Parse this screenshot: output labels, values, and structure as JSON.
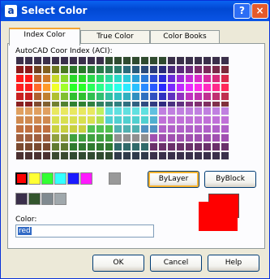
{
  "window": {
    "title": "Select Color",
    "icon_letter": "a"
  },
  "titlebar_buttons": {
    "help_label": "?",
    "close_label": "×"
  },
  "tabs": [
    {
      "label": "Index Color",
      "active": true
    },
    {
      "label": "True Color",
      "active": false
    },
    {
      "label": "Color Books",
      "active": false
    }
  ],
  "aci_label": "AutoCAD Coor Index (ACI):",
  "palette_cols": 24,
  "palette_top": [
    [
      "#3a2f4a",
      "#3a2f4a",
      "#3a2f4a",
      "#3a2f4a",
      "#3a2f4a",
      "#3a2f4a",
      "#3a2f4a",
      "#3a2f4a",
      "#3a2f4a",
      "#3a2f4a",
      "#2f4a2f",
      "#2f4a2f",
      "#2f4a2f",
      "#2f4a2f",
      "#2f4a2f",
      "#2f4a2f",
      "#2f4a2f",
      "#3a2f4a",
      "#3a2f4a",
      "#3a2f4a",
      "#3a2f4a",
      "#3a2f4a",
      "#3a2f4a",
      "#3a2f4a"
    ],
    [
      "#8b1a1a",
      "#8b1a1a",
      "#704020",
      "#806020",
      "#6e7a20",
      "#4a7a20",
      "#2a7a2a",
      "#2a7a2a",
      "#2a7a3a",
      "#2a7a4a",
      "#2a7a5a",
      "#2a7a6a",
      "#2a6a7a",
      "#2a5a7a",
      "#2a4a7a",
      "#2a3a7a",
      "#2a2a7a",
      "#4a2a7a",
      "#5a2a7a",
      "#6a2a7a",
      "#7a2a6a",
      "#7a2a5a",
      "#7a2a4a",
      "#7a2a3a"
    ],
    [
      "#ff1a1a",
      "#ff1a1a",
      "#c0602a",
      "#d07a2a",
      "#c8d82a",
      "#8ed82a",
      "#2ad82a",
      "#2ad82a",
      "#2ad84a",
      "#2ad86a",
      "#2ad8a0",
      "#2ad8c8",
      "#2ac8d8",
      "#2aa0d8",
      "#2a7ad8",
      "#2a4ad8",
      "#2a2ad8",
      "#6a2ad8",
      "#a02ad8",
      "#c82ad8",
      "#d82ac8",
      "#d82aa0",
      "#d82a7a",
      "#d82a4a"
    ],
    [
      "#ff2020",
      "#ff2020",
      "#ff6a2a",
      "#ff9a2a",
      "#f0ff2a",
      "#a0ff2a",
      "#2aff2a",
      "#2aff2a",
      "#2aff5a",
      "#2aff8a",
      "#2affc0",
      "#2affea",
      "#2aeaff",
      "#2ac0ff",
      "#2a8aff",
      "#2a5aff",
      "#2a2aff",
      "#7a2aff",
      "#c02aff",
      "#ea2aff",
      "#ff2aea",
      "#ff2ac0",
      "#ff2a8a",
      "#ff2a5a"
    ],
    [
      "#c82020",
      "#c82020",
      "#b06030",
      "#c08030",
      "#b0c030",
      "#80c030",
      "#30c030",
      "#30c030",
      "#30c050",
      "#30c070",
      "#30c0a0",
      "#30c0c0",
      "#30b0c0",
      "#3090c0",
      "#3070c0",
      "#3050c0",
      "#3030c0",
      "#6030c0",
      "#9030c0",
      "#c030c0",
      "#c030b0",
      "#c03090",
      "#c03070",
      "#c03050"
    ],
    [
      "#8a2020",
      "#8a2020",
      "#804a30",
      "#806030",
      "#708030",
      "#508030",
      "#308030",
      "#308030",
      "#308040",
      "#308060",
      "#308070",
      "#308080",
      "#307080",
      "#306080",
      "#304a80",
      "#303a80",
      "#302a80",
      "#4a3080",
      "#603080",
      "#803080",
      "#803070",
      "#803060",
      "#80304a",
      "#80303a"
    ],
    [
      "#3a2f4a",
      "#3a2f4a",
      "#3a2f4a",
      "#3a2f4a",
      "#3a2f4a",
      "#3a2f4a",
      "#3a2f4a",
      "#3a2f4a",
      "#3a2f4a",
      "#3a2f4a",
      "#3a2f4a",
      "#3a2f4a",
      "#3a2f4a",
      "#3a2f4a",
      "#3a2f4a",
      "#3a2f4a",
      "#3a2f4a",
      "#3a2f4a",
      "#3a2f4a",
      "#3a2f4a",
      "#3a2f4a",
      "#3a2f4a",
      "#3a2f4a",
      "#3a2f4a"
    ]
  ],
  "palette_bottom": [
    [
      "#e0a060",
      "#e0a060",
      "#e0a060",
      "#e0a060",
      "#e8e860",
      "#e8e860",
      "#e8e860",
      "#e8e860",
      "#e8e860",
      "#c0f060",
      "#60e0e0",
      "#60e0e0",
      "#60e0e0",
      "#60e0e0",
      "#60e0e0",
      "#60c0e0",
      "#c080e0",
      "#c080e0",
      "#c080e0",
      "#c080e0",
      "#c080e0",
      "#c080e0",
      "#c080e0",
      "#c080e0"
    ],
    [
      "#d08a50",
      "#d08a50",
      "#d08a50",
      "#d08a50",
      "#d8e050",
      "#d8e050",
      "#d8e050",
      "#d8e050",
      "#d8e050",
      "#b0e050",
      "#50d0d0",
      "#50d0d0",
      "#50d0d0",
      "#50d0d0",
      "#50d0d0",
      "#50b0d0",
      "#c070d8",
      "#c070d8",
      "#c070d8",
      "#c070d8",
      "#c070d8",
      "#c070d8",
      "#c070d8",
      "#c070d8"
    ],
    [
      "#c07040",
      "#c07040",
      "#c07040",
      "#c07040",
      "#c8d040",
      "#c8d040",
      "#c8d040",
      "#c8d040",
      "#50c050",
      "#50c050",
      "#50c050",
      "#50b0b0",
      "#50b0b0",
      "#50b0b0",
      "#5090c0",
      "#5090c0",
      "#b060c8",
      "#b060c8",
      "#b060c8",
      "#b060c8",
      "#b060c8",
      "#b060c8",
      "#b060c8",
      "#b060c8"
    ],
    [
      "#a06040",
      "#a06040",
      "#a06040",
      "#a06040",
      "#90a040",
      "#90a040",
      "#40a040",
      "#40a040",
      "#40a040",
      "#40a040",
      "#40a040",
      "#909090",
      "#909090",
      "#909090",
      "#909090",
      "#a050b0",
      "#a050b0",
      "#a050b0",
      "#a050b0",
      "#a050b0",
      "#a050b0",
      "#a050b0",
      "#a050b0",
      "#a050b0"
    ],
    [
      "#7a4a30",
      "#7a4a30",
      "#7a4a30",
      "#7a4a30",
      "#607a30",
      "#607a30",
      "#307a30",
      "#307a30",
      "#307a30",
      "#307a30",
      "#307a30",
      "#306a6a",
      "#306a6a",
      "#306a6a",
      "#306a6a",
      "#6a306a",
      "#6a306a",
      "#6a306a",
      "#6a306a",
      "#6a306a",
      "#6a306a",
      "#6a306a",
      "#6a306a",
      "#6a306a"
    ],
    [
      "#4a3030",
      "#4a3030",
      "#4a3030",
      "#4a3030",
      "#3a4a30",
      "#3a4a30",
      "#304a30",
      "#304a30",
      "#304a30",
      "#304a30",
      "#304a30",
      "#303a4a",
      "#303a4a",
      "#303a4a",
      "#303a4a",
      "#3a304a",
      "#3a304a",
      "#3a304a",
      "#3a304a",
      "#3a304a",
      "#3a304a",
      "#3a304a",
      "#3a304a",
      "#3a304a"
    ]
  ],
  "standard_colors": [
    "#ff0000",
    "#ffff33",
    "#33ff33",
    "#33ffff",
    "#1a1aff",
    "#ff1aff"
  ],
  "standard_extra": "#999999",
  "gray_swatches": [
    "#3a2f4a",
    "#33552d",
    "#808a90",
    "#a0a8ac"
  ],
  "bylayer_label": "ByLayer",
  "byblock_label": "ByBlock",
  "color_field_label": "Color:",
  "color_value": "red",
  "preview_colors": {
    "old": "#ff0000",
    "new": "#ff0000"
  },
  "footer": {
    "ok_label": "OK",
    "cancel_label": "Cancel",
    "help_label": "Help"
  }
}
